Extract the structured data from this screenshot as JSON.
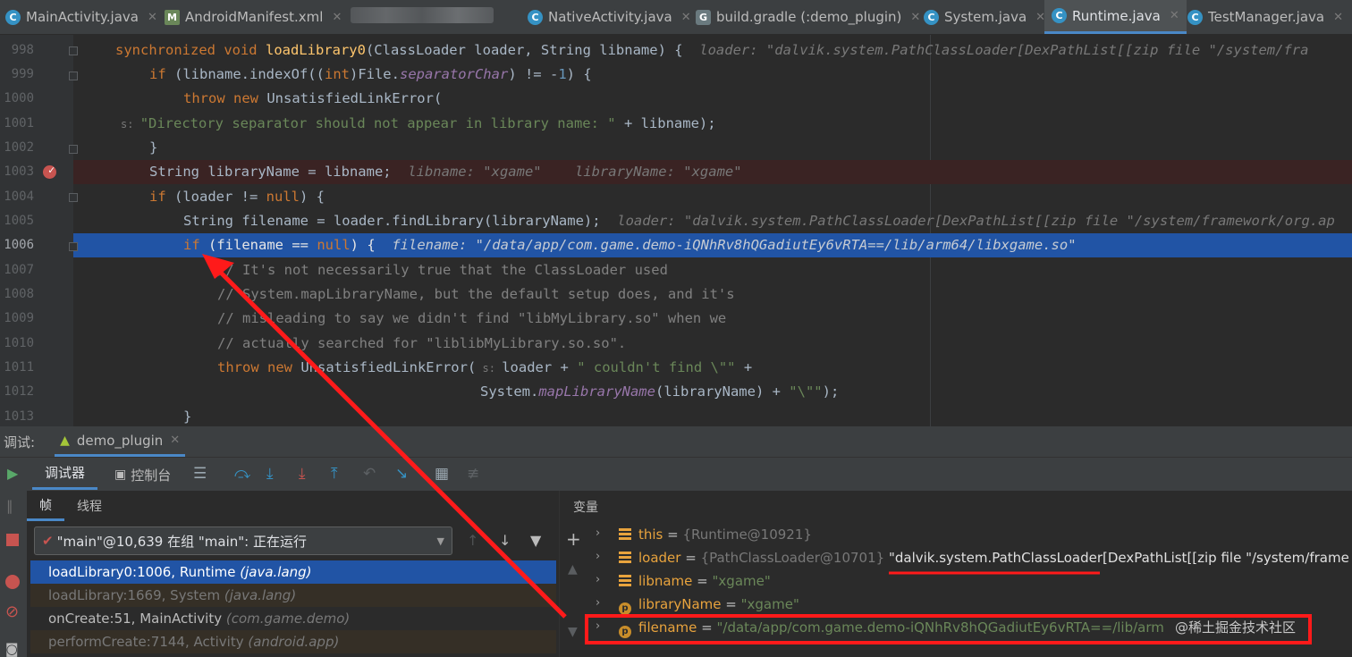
{
  "tabs": [
    {
      "label": "MainActivity.java",
      "icon": "c"
    },
    {
      "label": "AndroidManifest.xml",
      "icon": "mf"
    },
    {
      "label": "NativeActivity.java",
      "icon": "c"
    },
    {
      "label": "build.gradle (:demo_plugin)",
      "icon": "gradle"
    },
    {
      "label": "System.java",
      "icon": "c"
    },
    {
      "label": "Runtime.java",
      "icon": "c"
    },
    {
      "label": "TestManager.java",
      "icon": "c"
    }
  ],
  "editor": {
    "line_numbers": [
      "998",
      "999",
      "1000",
      "1001",
      "1002",
      "1003",
      "1004",
      "1005",
      "1006",
      "1007",
      "1008",
      "1009",
      "1010",
      "1011",
      "1012",
      "1013"
    ],
    "l998": {
      "kw1": "synchronized void ",
      "fn": "loadLibrary0",
      "rest": "(ClassLoader loader, String libname) {",
      "hint": "loader: \"dalvik.system.PathClassLoader[DexPathList[[zip file \"/system/fra"
    },
    "l999": {
      "kw": "if ",
      "a": "(libname.indexOf((",
      "kw2": "int",
      "b": ")File.",
      "field": "separatorChar",
      "c": ") != -",
      "num": "1",
      "d": ") {"
    },
    "l1000": {
      "kw": "throw new ",
      "rest": "UnsatisfiedLinkError("
    },
    "l1001": {
      "s": "s: ",
      "str": "\"Directory separator should not appear in library name: \"",
      "rest": " + libname);"
    },
    "l1002": {
      "rest": "}"
    },
    "l1003": {
      "rest": "String libraryName = libname;",
      "hint1": "libname: \"xgame\"",
      "hint2": "libraryName: \"xgame\""
    },
    "l1004": {
      "kw": "if ",
      "a": "(loader != ",
      "kw2": "null",
      "b": ") {"
    },
    "l1005": {
      "rest": "String filename = loader.findLibrary(libraryName);",
      "hint": "loader: \"dalvik.system.PathClassLoader[DexPathList[[zip file \"/system/framework/org.ap"
    },
    "l1006": {
      "kw": "if ",
      "a": "(filename == ",
      "kw2": "null",
      "b": ") {",
      "hint": "filename: \"/data/app/com.game.demo-iQNhRv8hQGadiutEy6vRTA==/lib/arm64/libxgame.so\""
    },
    "l1007": "// It's not necessarily true that the ClassLoader used",
    "l1008": "// System.mapLibraryName, but the default setup does, and it's",
    "l1009": "// misleading to say we didn't find \"libMyLibrary.so\" when we",
    "l1010": "// actually searched for \"liblibMyLibrary.so.so\".",
    "l1011": {
      "kw": "throw new ",
      "a": "UnsatisfiedLinkError(",
      "s": " s: ",
      "b": "loader + ",
      "str": "\" couldn't find \\\"\"",
      "c": " +"
    },
    "l1012": {
      "a": "System.",
      "it": "mapLibraryName",
      "b": "(libraryName) + ",
      "str": "\"\\\"\"",
      "c": ");"
    },
    "l1013": "}"
  },
  "debug": {
    "label": "调试:",
    "session": "demo_plugin",
    "tab_debugger": "调试器",
    "tab_console": "控制台",
    "subtab_frames": "帧",
    "subtab_threads": "线程",
    "vars_title": "变量",
    "thread_select": "\"main\"@10,639 在组 \"main\": 正在运行",
    "frames": [
      {
        "method": "loadLibrary0:1006, Runtime ",
        "pkg": "(java.lang)"
      },
      {
        "method": "loadLibrary:1669, System ",
        "pkg": "(java.lang)"
      },
      {
        "method": "onCreate:51, MainActivity ",
        "pkg": "(com.game.demo)"
      },
      {
        "method": "performCreate:7144, Activity ",
        "pkg": "(android.app)"
      }
    ],
    "variables": [
      {
        "name": "this",
        "eq": " = ",
        "type": "{Runtime@10921}",
        "value": ""
      },
      {
        "name": "loader",
        "eq": " = ",
        "type": "{PathClassLoader@10701}",
        "value": " \"dalvik.system.PathClassLoader[DexPathList[[zip file \"/system/frame"
      },
      {
        "name": "libname",
        "eq": " = ",
        "type": "",
        "value": "\"xgame\""
      },
      {
        "name": "libraryName",
        "eq": " = ",
        "type": "",
        "value": "\"xgame\""
      },
      {
        "name": "filename",
        "eq": " = ",
        "type": "",
        "value": "\"/data/app/com.game.demo-iQNhRv8hQGadiutEy6vRTA==/lib/arm"
      }
    ],
    "watermark": "@稀土掘金技术社区"
  },
  "colors": {
    "annotation_red": "#ff1a1a",
    "current_line": "#2154a5",
    "accent": "#4a88c7"
  }
}
